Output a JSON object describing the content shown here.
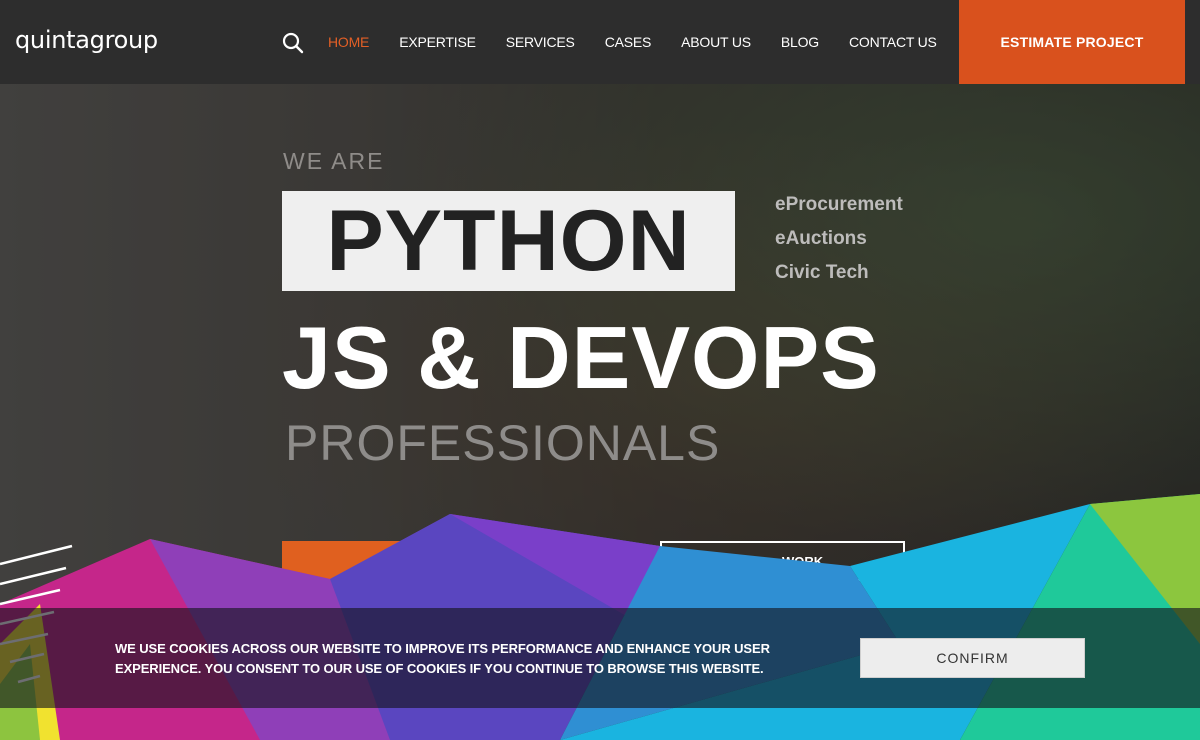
{
  "header": {
    "logo": "quintagroup",
    "search_icon": "search-icon",
    "nav": [
      "HOME",
      "EXPERTISE",
      "SERVICES",
      "CASES",
      "ABOUT US",
      "BLOG",
      "CONTACT US"
    ],
    "active_nav": "HOME",
    "cta_label": "ESTIMATE PROJECT"
  },
  "hero": {
    "we_are": "WE ARE",
    "highlight": "PYTHON",
    "tags": [
      "eProcurement",
      "eAuctions",
      "Civic Tech"
    ],
    "headline": "JS & DEVOPS",
    "subheadline": "PROFESSIONALS",
    "secondary_button_label": "WORK"
  },
  "cookie_bar": {
    "text": "WE USE COOKIES ACROSS OUR WEBSITE TO IMPROVE ITS PERFORMANCE AND ENHANCE YOUR USER EXPERIENCE. YOU CONSENT TO OUR USE OF COOKIES IF YOU CONTINUE TO BROWSE THIS WEBSITE.",
    "confirm_label": "CONFIRM"
  },
  "colors": {
    "accent": "#e25f26",
    "header_bg": "#2d2d2d",
    "cta_bg": "#d9511d"
  }
}
